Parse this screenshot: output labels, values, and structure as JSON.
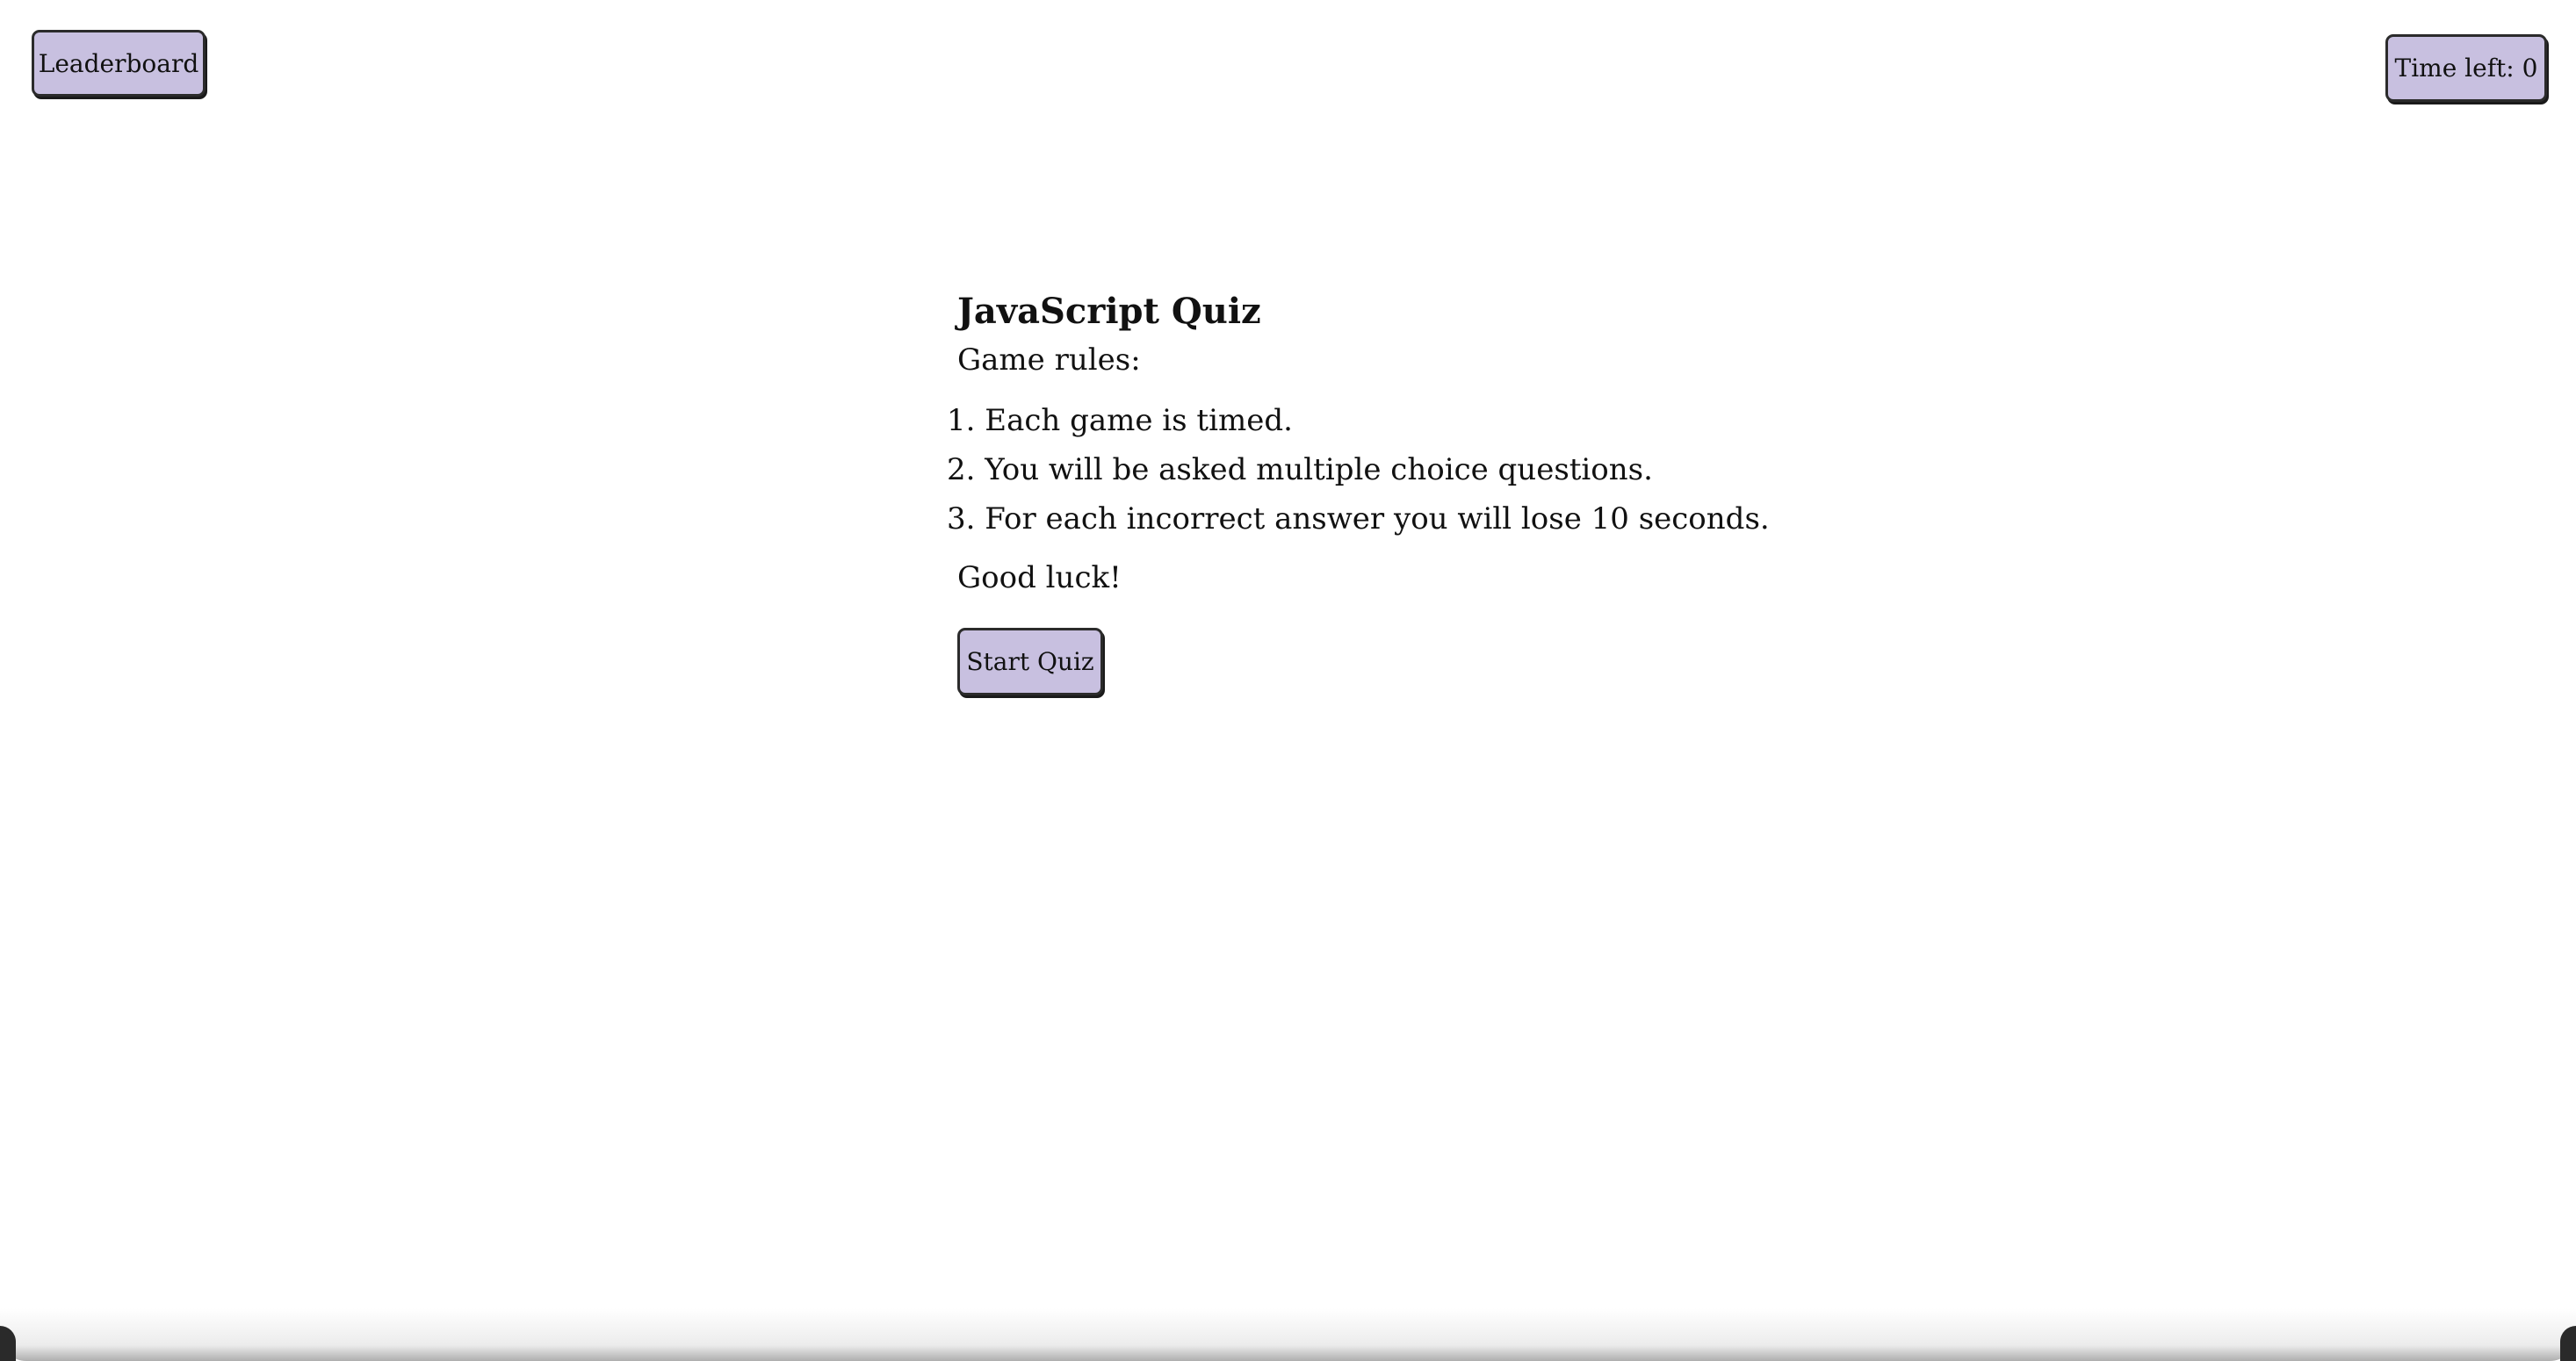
{
  "header": {
    "leaderboard_label": "Leaderboard",
    "timer_label": "Time left:",
    "timer_value": "0"
  },
  "quiz": {
    "title": "JavaScript Quiz",
    "rules_label": "Game rules:",
    "rules": [
      {
        "number": "1.",
        "text": "Each game is timed."
      },
      {
        "number": "2.",
        "text": "You will be asked multiple choice questions."
      },
      {
        "number": "3.",
        "text": "For each incorrect answer you will lose 10 seconds."
      }
    ],
    "closing": "Good luck!",
    "start_label": "Start Quiz"
  },
  "colors": {
    "button_bg": "#c8c0e0",
    "button_border": "#2b2b2b",
    "page_bg": "#ffffff"
  }
}
